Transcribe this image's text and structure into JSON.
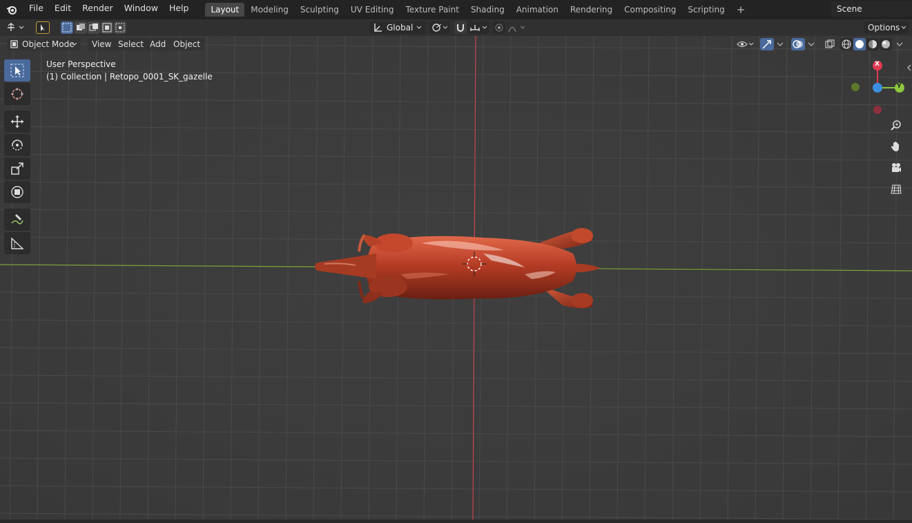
{
  "menu": {
    "items": [
      "File",
      "Edit",
      "Render",
      "Window",
      "Help"
    ]
  },
  "workspaces": {
    "tabs": [
      "Layout",
      "Modeling",
      "Sculpting",
      "UV Editing",
      "Texture Paint",
      "Shading",
      "Animation",
      "Rendering",
      "Compositing",
      "Scripting"
    ],
    "active": "Layout",
    "add_label": "+"
  },
  "scene": {
    "name": "Scene"
  },
  "toolheader": {
    "orientation": "Global",
    "options_label": "Options"
  },
  "viewport_header": {
    "mode": "Object Mode",
    "menus": [
      "View",
      "Select",
      "Add",
      "Object"
    ]
  },
  "overlay": {
    "perspective": "User Perspective",
    "collection": "(1) Collection | Retopo_0001_SK_gazelle"
  },
  "gizmo": {
    "x_label": "X",
    "y_label": "Y"
  },
  "colors": {
    "x_axis": "#e03a52",
    "y_axis": "#8cc63f",
    "z_axis": "#3d8ee0",
    "accent": "#4a6a9c",
    "object": "#c0432a"
  }
}
